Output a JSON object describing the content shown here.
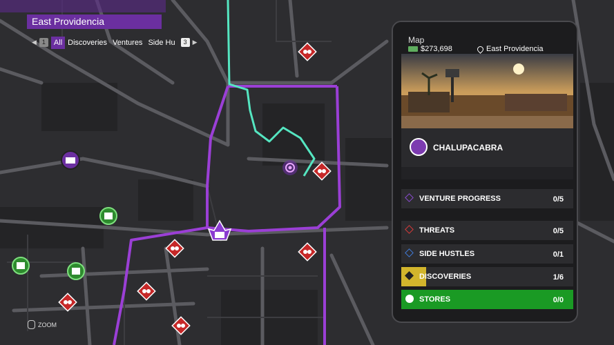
{
  "region": {
    "title": "East Providencia"
  },
  "filters": {
    "left_key": "1",
    "tabs": [
      "All",
      "Discoveries",
      "Ventures",
      "Side Hu"
    ],
    "active": "All",
    "right_key": "3"
  },
  "zoom_hint": {
    "label": "ZOOM"
  },
  "panel": {
    "title": "Map",
    "cash": "$273,698",
    "location": "East Providencia",
    "venture": {
      "name": "CHALUPACABRA"
    },
    "stats": [
      {
        "label": "VENTURE PROGRESS",
        "count": "0/5",
        "color": "#8a4bd0"
      },
      {
        "label": "THREATS",
        "count": "0/5",
        "color": "#d83a3a"
      },
      {
        "label": "SIDE HUSTLES",
        "count": "0/1",
        "color": "#3f7ad8"
      },
      {
        "label": "DISCOVERIES",
        "count": "1/6",
        "color": "#d2b52c"
      },
      {
        "label": "STORES",
        "count": "0/0",
        "color": "#1a9a24"
      }
    ]
  },
  "map_icons": [
    {
      "name": "threat-icon"
    },
    {
      "name": "threat-icon"
    },
    {
      "name": "threat-icon"
    },
    {
      "name": "threat-icon"
    },
    {
      "name": "threat-icon"
    },
    {
      "name": "threat-icon"
    },
    {
      "name": "threat-icon"
    },
    {
      "name": "clothing-store-icon"
    },
    {
      "name": "clothing-store-icon"
    },
    {
      "name": "gun-store-icon"
    },
    {
      "name": "venture-icon"
    },
    {
      "name": "saints-hq-icon"
    },
    {
      "name": "player-marker-icon"
    }
  ]
}
